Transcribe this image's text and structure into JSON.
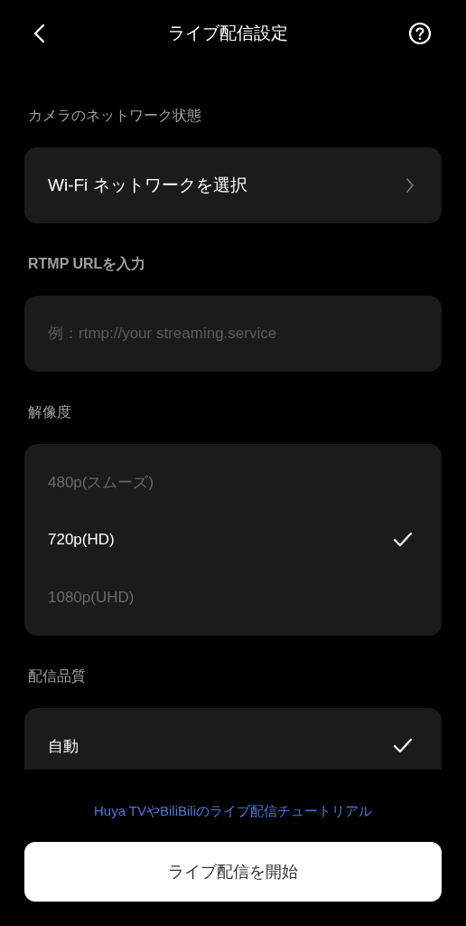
{
  "header": {
    "title": "ライブ配信設定"
  },
  "network": {
    "label": "カメラのネットワーク状態",
    "item": "Wi-Fi ネットワークを選択"
  },
  "rtmp": {
    "label": "RTMP URLを入力",
    "placeholder": "例：rtmp://your streaming.service"
  },
  "resolution": {
    "label": "解像度",
    "options": [
      {
        "text": "480p(スムーズ)",
        "selected": false
      },
      {
        "text": "720p(HD)",
        "selected": true
      },
      {
        "text": "1080p(UHD)",
        "selected": false
      }
    ]
  },
  "quality": {
    "label": "配信品質",
    "options": [
      {
        "text": "自動",
        "selected": true
      }
    ]
  },
  "tutorial_link": "Huya TVやBiliBiliのライブ配信チュートリアル",
  "start_button": "ライブ配信を開始"
}
